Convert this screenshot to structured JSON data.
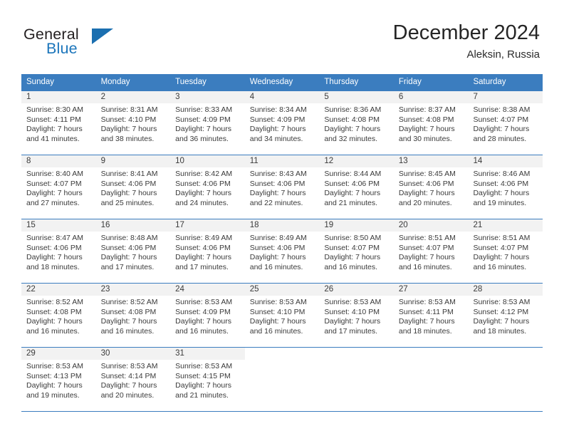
{
  "brand": {
    "word_one": "General",
    "word_two": "Blue",
    "triangle_icon": "triangle-logo-icon",
    "accent_color": "#1b75bb"
  },
  "header": {
    "title": "December 2024",
    "location": "Aleksin, Russia"
  },
  "theme": {
    "header_blue": "#3b7dbf",
    "day_band_gray": "#f2f2f2",
    "text": "#3a3a3a"
  },
  "weekdays": [
    "Sunday",
    "Monday",
    "Tuesday",
    "Wednesday",
    "Thursday",
    "Friday",
    "Saturday"
  ],
  "weeks": [
    [
      {
        "day": "1",
        "sunrise": "Sunrise: 8:30 AM",
        "sunset": "Sunset: 4:11 PM",
        "daylight_line1": "Daylight: 7 hours",
        "daylight_line2": "and 41 minutes."
      },
      {
        "day": "2",
        "sunrise": "Sunrise: 8:31 AM",
        "sunset": "Sunset: 4:10 PM",
        "daylight_line1": "Daylight: 7 hours",
        "daylight_line2": "and 38 minutes."
      },
      {
        "day": "3",
        "sunrise": "Sunrise: 8:33 AM",
        "sunset": "Sunset: 4:09 PM",
        "daylight_line1": "Daylight: 7 hours",
        "daylight_line2": "and 36 minutes."
      },
      {
        "day": "4",
        "sunrise": "Sunrise: 8:34 AM",
        "sunset": "Sunset: 4:09 PM",
        "daylight_line1": "Daylight: 7 hours",
        "daylight_line2": "and 34 minutes."
      },
      {
        "day": "5",
        "sunrise": "Sunrise: 8:36 AM",
        "sunset": "Sunset: 4:08 PM",
        "daylight_line1": "Daylight: 7 hours",
        "daylight_line2": "and 32 minutes."
      },
      {
        "day": "6",
        "sunrise": "Sunrise: 8:37 AM",
        "sunset": "Sunset: 4:08 PM",
        "daylight_line1": "Daylight: 7 hours",
        "daylight_line2": "and 30 minutes."
      },
      {
        "day": "7",
        "sunrise": "Sunrise: 8:38 AM",
        "sunset": "Sunset: 4:07 PM",
        "daylight_line1": "Daylight: 7 hours",
        "daylight_line2": "and 28 minutes."
      }
    ],
    [
      {
        "day": "8",
        "sunrise": "Sunrise: 8:40 AM",
        "sunset": "Sunset: 4:07 PM",
        "daylight_line1": "Daylight: 7 hours",
        "daylight_line2": "and 27 minutes."
      },
      {
        "day": "9",
        "sunrise": "Sunrise: 8:41 AM",
        "sunset": "Sunset: 4:06 PM",
        "daylight_line1": "Daylight: 7 hours",
        "daylight_line2": "and 25 minutes."
      },
      {
        "day": "10",
        "sunrise": "Sunrise: 8:42 AM",
        "sunset": "Sunset: 4:06 PM",
        "daylight_line1": "Daylight: 7 hours",
        "daylight_line2": "and 24 minutes."
      },
      {
        "day": "11",
        "sunrise": "Sunrise: 8:43 AM",
        "sunset": "Sunset: 4:06 PM",
        "daylight_line1": "Daylight: 7 hours",
        "daylight_line2": "and 22 minutes."
      },
      {
        "day": "12",
        "sunrise": "Sunrise: 8:44 AM",
        "sunset": "Sunset: 4:06 PM",
        "daylight_line1": "Daylight: 7 hours",
        "daylight_line2": "and 21 minutes."
      },
      {
        "day": "13",
        "sunrise": "Sunrise: 8:45 AM",
        "sunset": "Sunset: 4:06 PM",
        "daylight_line1": "Daylight: 7 hours",
        "daylight_line2": "and 20 minutes."
      },
      {
        "day": "14",
        "sunrise": "Sunrise: 8:46 AM",
        "sunset": "Sunset: 4:06 PM",
        "daylight_line1": "Daylight: 7 hours",
        "daylight_line2": "and 19 minutes."
      }
    ],
    [
      {
        "day": "15",
        "sunrise": "Sunrise: 8:47 AM",
        "sunset": "Sunset: 4:06 PM",
        "daylight_line1": "Daylight: 7 hours",
        "daylight_line2": "and 18 minutes."
      },
      {
        "day": "16",
        "sunrise": "Sunrise: 8:48 AM",
        "sunset": "Sunset: 4:06 PM",
        "daylight_line1": "Daylight: 7 hours",
        "daylight_line2": "and 17 minutes."
      },
      {
        "day": "17",
        "sunrise": "Sunrise: 8:49 AM",
        "sunset": "Sunset: 4:06 PM",
        "daylight_line1": "Daylight: 7 hours",
        "daylight_line2": "and 17 minutes."
      },
      {
        "day": "18",
        "sunrise": "Sunrise: 8:49 AM",
        "sunset": "Sunset: 4:06 PM",
        "daylight_line1": "Daylight: 7 hours",
        "daylight_line2": "and 16 minutes."
      },
      {
        "day": "19",
        "sunrise": "Sunrise: 8:50 AM",
        "sunset": "Sunset: 4:07 PM",
        "daylight_line1": "Daylight: 7 hours",
        "daylight_line2": "and 16 minutes."
      },
      {
        "day": "20",
        "sunrise": "Sunrise: 8:51 AM",
        "sunset": "Sunset: 4:07 PM",
        "daylight_line1": "Daylight: 7 hours",
        "daylight_line2": "and 16 minutes."
      },
      {
        "day": "21",
        "sunrise": "Sunrise: 8:51 AM",
        "sunset": "Sunset: 4:07 PM",
        "daylight_line1": "Daylight: 7 hours",
        "daylight_line2": "and 16 minutes."
      }
    ],
    [
      {
        "day": "22",
        "sunrise": "Sunrise: 8:52 AM",
        "sunset": "Sunset: 4:08 PM",
        "daylight_line1": "Daylight: 7 hours",
        "daylight_line2": "and 16 minutes."
      },
      {
        "day": "23",
        "sunrise": "Sunrise: 8:52 AM",
        "sunset": "Sunset: 4:08 PM",
        "daylight_line1": "Daylight: 7 hours",
        "daylight_line2": "and 16 minutes."
      },
      {
        "day": "24",
        "sunrise": "Sunrise: 8:53 AM",
        "sunset": "Sunset: 4:09 PM",
        "daylight_line1": "Daylight: 7 hours",
        "daylight_line2": "and 16 minutes."
      },
      {
        "day": "25",
        "sunrise": "Sunrise: 8:53 AM",
        "sunset": "Sunset: 4:10 PM",
        "daylight_line1": "Daylight: 7 hours",
        "daylight_line2": "and 16 minutes."
      },
      {
        "day": "26",
        "sunrise": "Sunrise: 8:53 AM",
        "sunset": "Sunset: 4:10 PM",
        "daylight_line1": "Daylight: 7 hours",
        "daylight_line2": "and 17 minutes."
      },
      {
        "day": "27",
        "sunrise": "Sunrise: 8:53 AM",
        "sunset": "Sunset: 4:11 PM",
        "daylight_line1": "Daylight: 7 hours",
        "daylight_line2": "and 18 minutes."
      },
      {
        "day": "28",
        "sunrise": "Sunrise: 8:53 AM",
        "sunset": "Sunset: 4:12 PM",
        "daylight_line1": "Daylight: 7 hours",
        "daylight_line2": "and 18 minutes."
      }
    ],
    [
      {
        "day": "29",
        "sunrise": "Sunrise: 8:53 AM",
        "sunset": "Sunset: 4:13 PM",
        "daylight_line1": "Daylight: 7 hours",
        "daylight_line2": "and 19 minutes."
      },
      {
        "day": "30",
        "sunrise": "Sunrise: 8:53 AM",
        "sunset": "Sunset: 4:14 PM",
        "daylight_line1": "Daylight: 7 hours",
        "daylight_line2": "and 20 minutes."
      },
      {
        "day": "31",
        "sunrise": "Sunrise: 8:53 AM",
        "sunset": "Sunset: 4:15 PM",
        "daylight_line1": "Daylight: 7 hours",
        "daylight_line2": "and 21 minutes."
      },
      {
        "day": "",
        "sunrise": "",
        "sunset": "",
        "daylight_line1": "",
        "daylight_line2": ""
      },
      {
        "day": "",
        "sunrise": "",
        "sunset": "",
        "daylight_line1": "",
        "daylight_line2": ""
      },
      {
        "day": "",
        "sunrise": "",
        "sunset": "",
        "daylight_line1": "",
        "daylight_line2": ""
      },
      {
        "day": "",
        "sunrise": "",
        "sunset": "",
        "daylight_line1": "",
        "daylight_line2": ""
      }
    ]
  ]
}
